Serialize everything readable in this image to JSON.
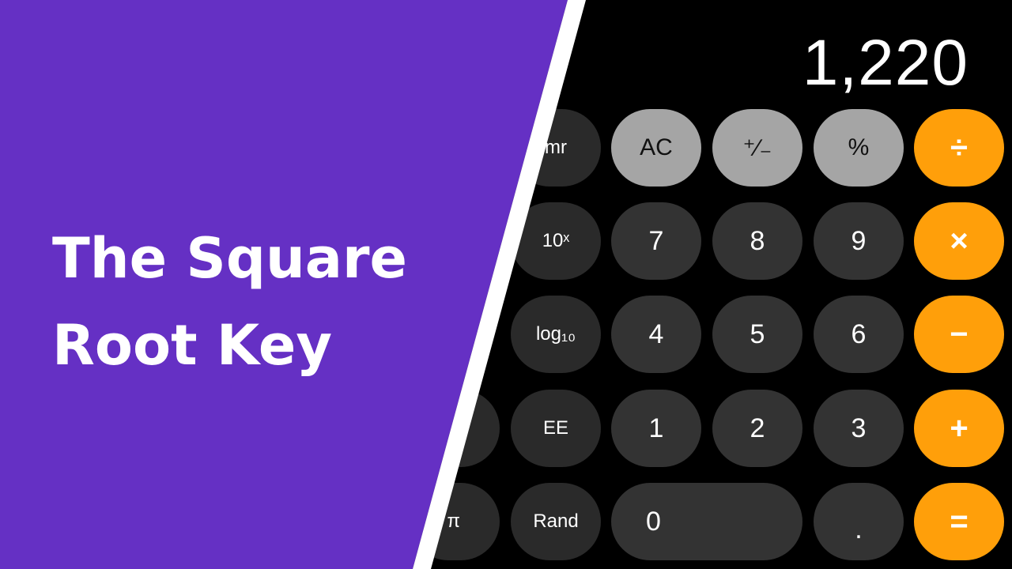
{
  "title": {
    "line1": "The Square",
    "line2": "Root Key"
  },
  "calculator": {
    "display_value": "1,220",
    "rows": [
      [
        {
          "id": "mr",
          "label": "mr",
          "kind": "sci"
        },
        {
          "id": "ac",
          "label": "AC",
          "kind": "fn"
        },
        {
          "id": "plus-minus",
          "label": "⁺∕₋",
          "kind": "fn"
        },
        {
          "id": "percent",
          "label": "%",
          "kind": "fn"
        },
        {
          "id": "divide",
          "label": "÷",
          "kind": "op"
        }
      ],
      [
        {
          "id": "ten-power-x",
          "label": "10ˣ",
          "kind": "sci"
        },
        {
          "id": "7",
          "label": "7",
          "kind": "num"
        },
        {
          "id": "8",
          "label": "8",
          "kind": "num"
        },
        {
          "id": "9",
          "label": "9",
          "kind": "num"
        },
        {
          "id": "multiply",
          "label": "×",
          "kind": "op"
        }
      ],
      [
        {
          "id": "log10",
          "label": "log₁₀",
          "kind": "sci"
        },
        {
          "id": "4",
          "label": "4",
          "kind": "num"
        },
        {
          "id": "5",
          "label": "5",
          "kind": "num"
        },
        {
          "id": "6",
          "label": "6",
          "kind": "num"
        },
        {
          "id": "minus",
          "label": "−",
          "kind": "op"
        }
      ],
      [
        {
          "id": "ee",
          "label": "EE",
          "kind": "sci"
        },
        {
          "id": "1",
          "label": "1",
          "kind": "num"
        },
        {
          "id": "2",
          "label": "2",
          "kind": "num"
        },
        {
          "id": "3",
          "label": "3",
          "kind": "num"
        },
        {
          "id": "plus",
          "label": "+",
          "kind": "op"
        }
      ],
      [
        {
          "id": "rand",
          "label": "Rand",
          "kind": "sci"
        },
        {
          "id": "0",
          "label": "0",
          "kind": "num",
          "wide": true
        },
        {
          "id": "decimal",
          "label": ".",
          "kind": "num"
        },
        {
          "id": "equals",
          "label": "=",
          "kind": "op"
        }
      ]
    ],
    "partial_keys": [
      {
        "id": "partial-row4",
        "label": ""
      },
      {
        "id": "pi",
        "label": "π"
      }
    ]
  },
  "colors": {
    "banner": "#6530c4",
    "stripe": "#ffffff",
    "operator": "#ff9f0a",
    "function": "#a5a5a5",
    "number": "#333333",
    "scientific": "#2a2a2a"
  }
}
